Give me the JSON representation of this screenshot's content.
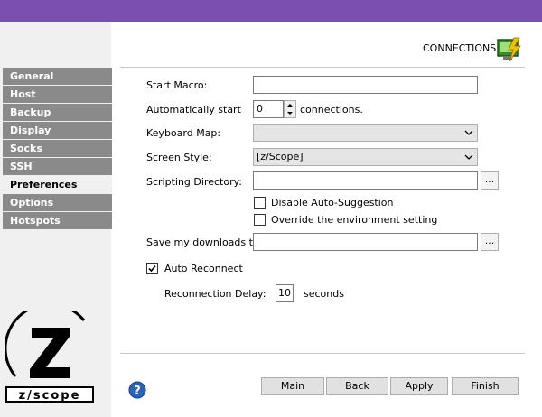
{
  "header": {
    "section_title": "CONNECTIONS"
  },
  "sidebar": {
    "items": [
      {
        "label": "General"
      },
      {
        "label": "Host"
      },
      {
        "label": "Backup"
      },
      {
        "label": "Display"
      },
      {
        "label": "Socks"
      },
      {
        "label": "SSH"
      },
      {
        "label": "Preferences",
        "active": true
      },
      {
        "label": "Options"
      },
      {
        "label": "Hotspots"
      }
    ],
    "logo_text": "z/scope"
  },
  "form": {
    "start_macro_label": "Start Macro:",
    "start_macro_value": "",
    "auto_start_label": "Automatically start",
    "auto_start_value": "0",
    "auto_start_suffix": "connections.",
    "keyboard_map_label": "Keyboard Map:",
    "keyboard_map_value": "",
    "screen_style_label": "Screen Style:",
    "screen_style_value": "[z/Scope]",
    "scripting_dir_label": "Scripting Directory:",
    "scripting_dir_value": "",
    "browse_label": "...",
    "disable_auto_suggestion_label": "Disable Auto-Suggestion",
    "disable_auto_suggestion_checked": false,
    "override_env_label": "Override the environment setting",
    "override_env_checked": false,
    "downloads_label": "Save my downloads to:",
    "downloads_value": "",
    "auto_reconnect_label": "Auto Reconnect",
    "auto_reconnect_checked": true,
    "reconnect_delay_label": "Reconnection Delay:",
    "reconnect_delay_value": "10",
    "reconnect_delay_suffix": "seconds"
  },
  "buttons": {
    "main": "Main",
    "back": "Back",
    "apply": "Apply",
    "finish": "Finish"
  },
  "colors": {
    "titlebar": "#7b4fb0",
    "sidebar_item": "#8a8a8a",
    "sidebar_bg": "#f0f0f0"
  }
}
